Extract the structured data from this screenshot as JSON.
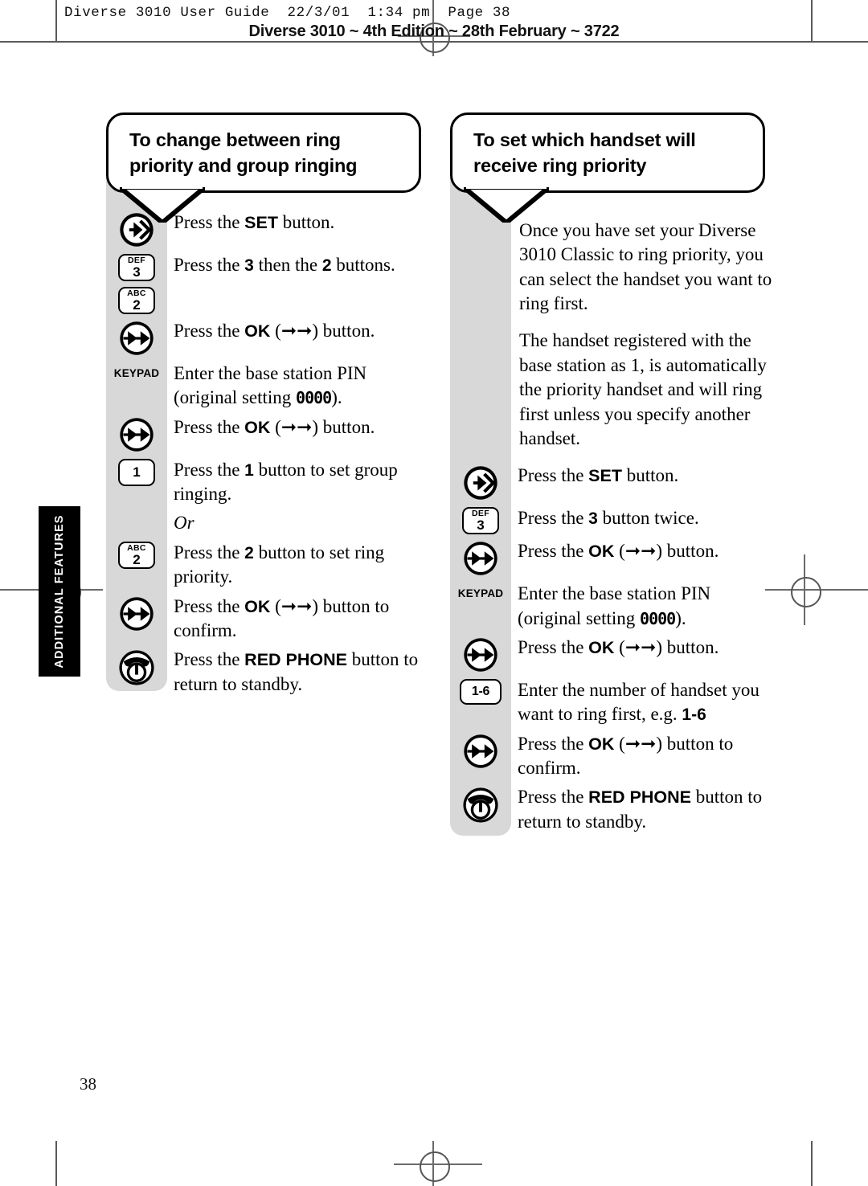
{
  "header": {
    "print_slug": "Diverse 3010 User Guide  22/3/01  1:34 pm  Page 38",
    "edition_line": "Diverse 3010 ~ 4th Edition ~ 28th February ~ 3722"
  },
  "side_tab": {
    "label": "ADDITIONAL FEATURES"
  },
  "page_number": "38",
  "columns": [
    {
      "id": "left",
      "callout_title": "To change between ring priority and group ringing",
      "steps": [
        {
          "icon": "set-button-icon",
          "icon_kind": "circle-set",
          "text_html": "Press the <b class=\"bt\">SET</b> button."
        },
        {
          "icon": "key-3-def-icon",
          "icon_kind": "key",
          "key_alpha": "DEF",
          "key_digit": "3",
          "text_html": "Press the <span class=\"numb\">3</span> then the <span class=\"numb\">2</span> buttons."
        },
        {
          "icon": "key-2-abc-icon",
          "icon_kind": "key",
          "key_alpha": "ABC",
          "key_digit": "2",
          "text_html": ""
        },
        {
          "icon": "ok-button-icon",
          "icon_kind": "circle-ok",
          "text_html": "Press the <b class=\"bt\">OK</b> (&#10142;&#10142;) button."
        },
        {
          "icon": "keypad-label-icon",
          "icon_kind": "keypad-text",
          "keypad_text": "KEYPAD",
          "text_html": "Enter the base station PIN<br>(original setting <span class=\"lcd\">0000</span>)."
        },
        {
          "icon": "ok-button-icon",
          "icon_kind": "circle-ok",
          "text_html": "Press the <b class=\"bt\">OK</b> (&#10142;&#10142;) button."
        },
        {
          "icon": "key-1-icon",
          "icon_kind": "key",
          "key_alpha": "",
          "key_digit": "1",
          "text_html": "Press the <span class=\"numb\">1</span> button to set group ringing."
        },
        {
          "icon": "or-separator",
          "icon_kind": "none",
          "text_html": "<i class=\"or\">Or</i>"
        },
        {
          "icon": "key-2-abc-icon",
          "icon_kind": "key",
          "key_alpha": "ABC",
          "key_digit": "2",
          "text_html": "Press the <span class=\"numb\">2</span> button to set ring priority."
        },
        {
          "icon": "ok-button-icon",
          "icon_kind": "circle-ok",
          "text_html": "Press the <b class=\"bt\">OK</b> (&#10142;&#10142;) button to confirm."
        },
        {
          "icon": "red-phone-button-icon",
          "icon_kind": "circle-phone",
          "text_html": "Press the <b class=\"bt\">RED PHONE</b> button to return to standby."
        }
      ]
    },
    {
      "id": "right",
      "callout_title": "To set which handset will receive ring priority",
      "intro_paragraphs": [
        "Once you have set your Diverse 3010 Classic to ring priority, you can select the handset you want to ring first.",
        "The handset registered with the base station as 1, is automatically the priority handset and will ring first unless you specify another handset."
      ],
      "steps": [
        {
          "icon": "set-button-icon",
          "icon_kind": "circle-set",
          "text_html": "Press the <b class=\"bt\">SET</b> button."
        },
        {
          "icon": "key-3-def-icon",
          "icon_kind": "key",
          "key_alpha": "DEF",
          "key_digit": "3",
          "text_html": "Press the <span class=\"numb\">3</span> button twice."
        },
        {
          "icon": "ok-button-icon",
          "icon_kind": "circle-ok",
          "text_html": "Press the <b class=\"bt\">OK</b> (&#10142;&#10142;) button."
        },
        {
          "icon": "keypad-label-icon",
          "icon_kind": "keypad-text",
          "keypad_text": "KEYPAD",
          "text_html": "Enter the base station PIN<br>(original setting <span class=\"lcd\">0000</span>)."
        },
        {
          "icon": "ok-button-icon",
          "icon_kind": "circle-ok",
          "text_html": "Press the <b class=\"bt\">OK</b> (&#10142;&#10142;) button."
        },
        {
          "icon": "key-1-6-icon",
          "icon_kind": "key-wide",
          "key_alpha": "",
          "key_digit": "1-6",
          "text_html": "Enter the number of handset you want to ring first, e.g. <span class=\"numb\">1-6</span>"
        },
        {
          "icon": "ok-button-icon",
          "icon_kind": "circle-ok",
          "text_html": "Press the <b class=\"bt\">OK</b> (&#10142;&#10142;) button to confirm."
        },
        {
          "icon": "red-phone-button-icon",
          "icon_kind": "circle-phone",
          "text_html": "Press the <b class=\"bt\">RED PHONE</b> button to&nbsp; return to standby."
        }
      ]
    }
  ],
  "colors": {
    "strip_gray": "#d8d8d8",
    "tab_black": "#000000",
    "ink": "#000000"
  }
}
